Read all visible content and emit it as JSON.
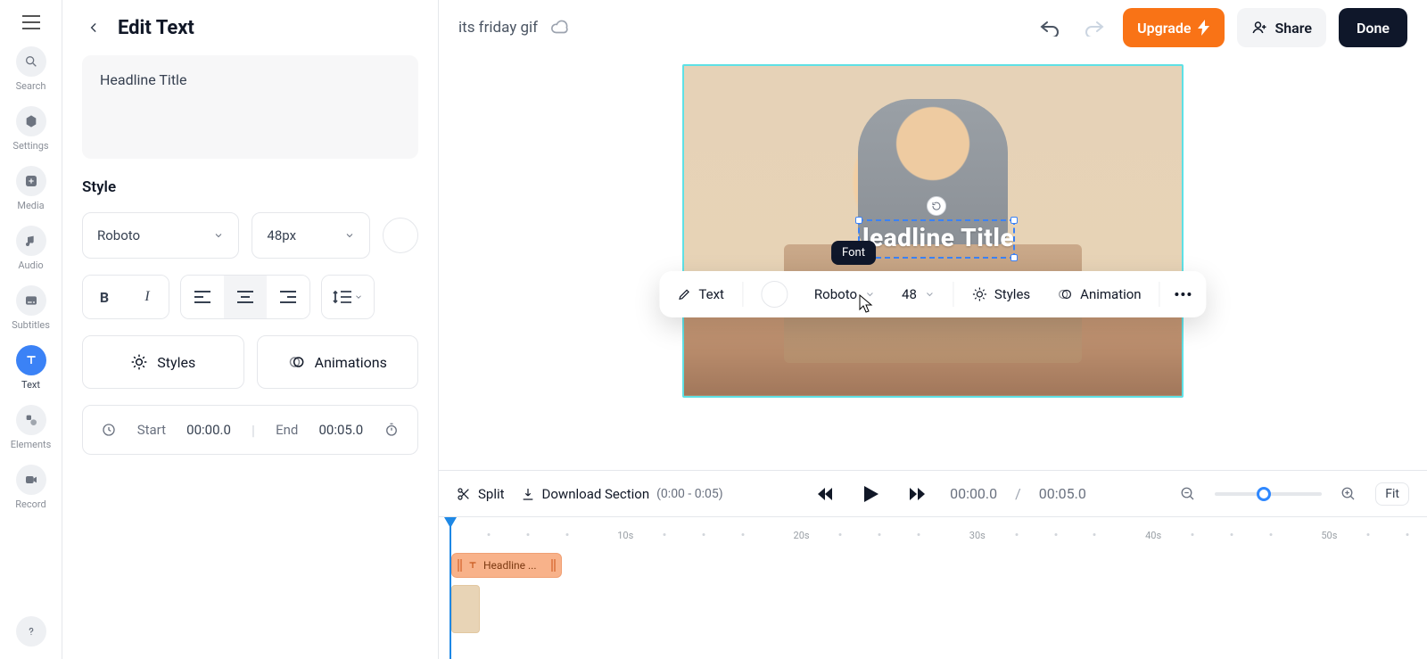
{
  "rail": {
    "items": [
      {
        "label": "Search"
      },
      {
        "label": "Settings"
      },
      {
        "label": "Media"
      },
      {
        "label": "Audio"
      },
      {
        "label": "Subtitles"
      },
      {
        "label": "Text"
      },
      {
        "label": "Elements"
      },
      {
        "label": "Record"
      }
    ],
    "active_index": 5
  },
  "side": {
    "title": "Edit Text",
    "text_value": "Headline Title",
    "style_label": "Style",
    "font": "Roboto",
    "size": "48px",
    "styles_label": "Styles",
    "animations_label": "Animations",
    "start_label": "Start",
    "start_value": "00:00.0",
    "end_label": "End",
    "end_value": "00:05.0"
  },
  "topbar": {
    "project_name": "its friday gif",
    "upgrade": "Upgrade",
    "share": "Share",
    "done": "Done"
  },
  "canvas": {
    "headline": "leadline Title",
    "float": {
      "text": "Text",
      "font": "Roboto",
      "size": "48",
      "styles": "Styles",
      "animation": "Animation",
      "tooltip": "Font"
    }
  },
  "transport": {
    "split": "Split",
    "download": "Download Section",
    "download_range": "(0:00 - 0:05)",
    "current": "00:00.0",
    "sep": "/",
    "duration": "00:05.0",
    "fit": "Fit"
  },
  "timeline": {
    "marks": [
      "10s",
      "20s",
      "30s",
      "40s",
      "50s"
    ],
    "clip_label": "Headline ..."
  }
}
